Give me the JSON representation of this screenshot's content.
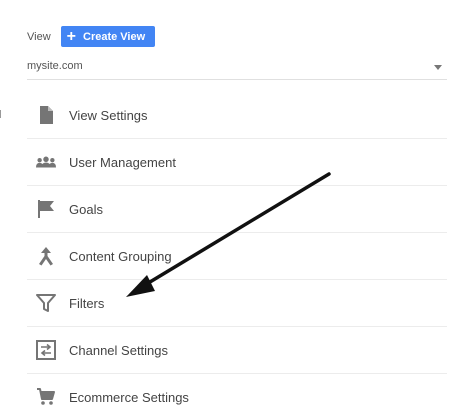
{
  "header": {
    "view_label": "View",
    "create_button_label": "Create View",
    "create_button_color": "#4285f4"
  },
  "view_selector": {
    "value": "mysite.com"
  },
  "menu": {
    "items": [
      {
        "label": "View Settings",
        "icon": "document-icon"
      },
      {
        "label": "User Management",
        "icon": "users-icon"
      },
      {
        "label": "Goals",
        "icon": "flag-icon"
      },
      {
        "label": "Content Grouping",
        "icon": "merge-icon"
      },
      {
        "label": "Filters",
        "icon": "filter-icon"
      },
      {
        "label": "Channel Settings",
        "icon": "channel-icon"
      },
      {
        "label": "Ecommerce Settings",
        "icon": "cart-icon"
      }
    ]
  },
  "colors": {
    "icon": "#757575",
    "annotation_arrow": "#111111"
  }
}
